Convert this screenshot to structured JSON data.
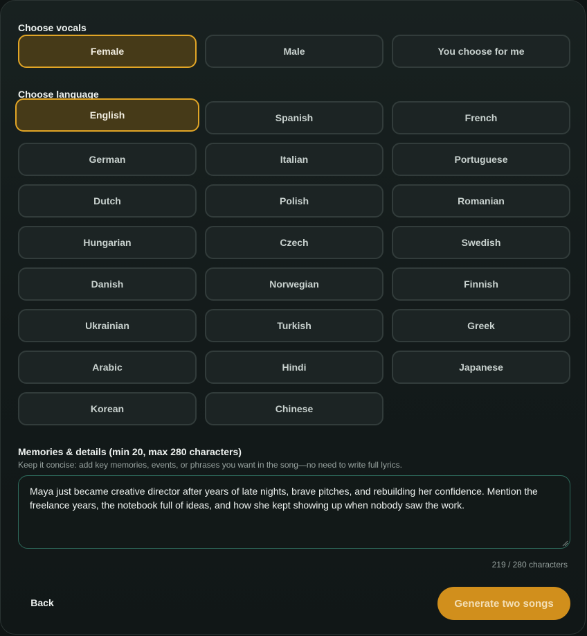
{
  "vocals": {
    "label": "Choose vocals",
    "options": [
      {
        "label": "Female",
        "selected": true
      },
      {
        "label": "Male",
        "selected": false
      },
      {
        "label": "You choose for me",
        "selected": false
      }
    ]
  },
  "language": {
    "label": "Choose language",
    "options": [
      {
        "label": "English",
        "selected": true
      },
      {
        "label": "Spanish",
        "selected": false
      },
      {
        "label": "French",
        "selected": false
      },
      {
        "label": "German",
        "selected": false
      },
      {
        "label": "Italian",
        "selected": false
      },
      {
        "label": "Portuguese",
        "selected": false
      },
      {
        "label": "Dutch",
        "selected": false
      },
      {
        "label": "Polish",
        "selected": false
      },
      {
        "label": "Romanian",
        "selected": false
      },
      {
        "label": "Hungarian",
        "selected": false
      },
      {
        "label": "Czech",
        "selected": false
      },
      {
        "label": "Swedish",
        "selected": false
      },
      {
        "label": "Danish",
        "selected": false
      },
      {
        "label": "Norwegian",
        "selected": false
      },
      {
        "label": "Finnish",
        "selected": false
      },
      {
        "label": "Ukrainian",
        "selected": false
      },
      {
        "label": "Turkish",
        "selected": false
      },
      {
        "label": "Greek",
        "selected": false
      },
      {
        "label": "Arabic",
        "selected": false
      },
      {
        "label": "Hindi",
        "selected": false
      },
      {
        "label": "Japanese",
        "selected": false
      },
      {
        "label": "Korean",
        "selected": false
      },
      {
        "label": "Chinese",
        "selected": false
      }
    ]
  },
  "memories": {
    "label": "Memories & details (min 20, max 280 characters)",
    "hint": "Keep it concise: add key memories, events, or phrases you want in the song—no need to write full lyrics.",
    "value": "Maya just became creative director after years of late nights, brave pitches, and rebuilding her confidence. Mention the freelance years, the notebook full of ideas, and how she kept showing up when nobody saw the work.",
    "counter": "219 / 280 characters"
  },
  "actions": {
    "back_label": "Back",
    "generate_label": "Generate two songs"
  },
  "colors": {
    "accent": "#e1a526",
    "selected_bg": "#463a18",
    "button": "#d18f1c"
  }
}
